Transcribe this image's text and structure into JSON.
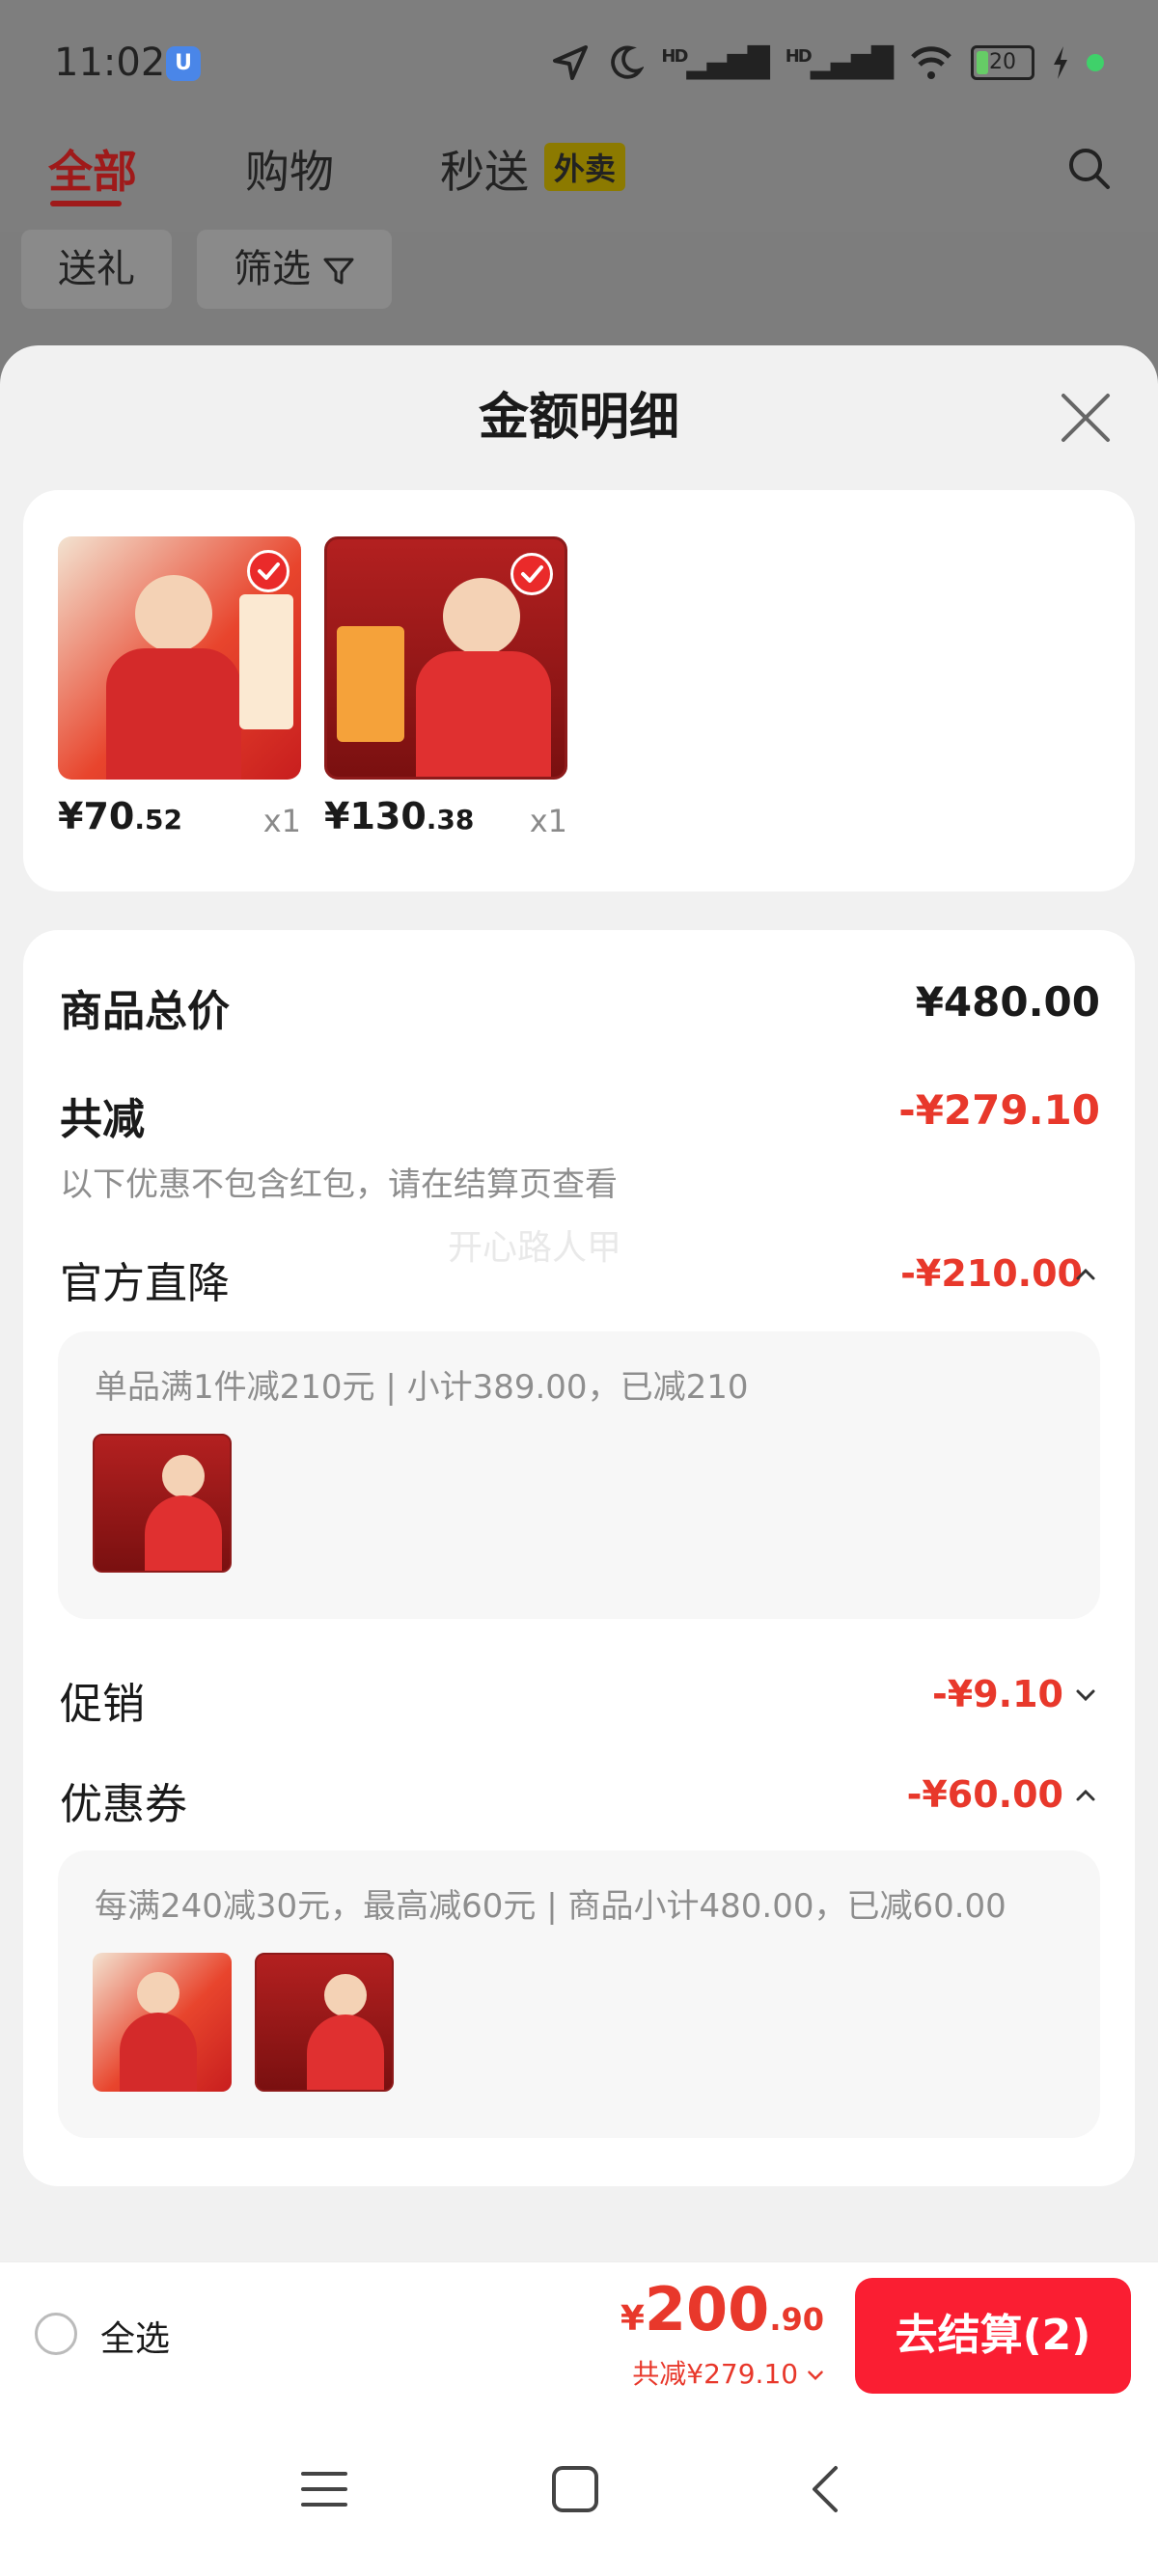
{
  "status_bar": {
    "time": "11:02",
    "battery": "20",
    "signal_1": "HD",
    "signal_2": "HD"
  },
  "top_tabs": [
    {
      "label": "全部",
      "active": true
    },
    {
      "label": "购物",
      "active": false
    },
    {
      "label": "秒送",
      "active": false
    }
  ],
  "waimai_badge": "外卖",
  "filters": {
    "gift_label": "送礼",
    "filter_label": "筛选"
  },
  "sheet": {
    "title": "金额明细",
    "watermark": "开心路人甲"
  },
  "products": [
    {
      "price_int": "¥70",
      "price_dec": ".52",
      "qty": "x1"
    },
    {
      "price_int": "¥130",
      "price_dec": ".38",
      "qty": "x1"
    }
  ],
  "details": {
    "total_label": "商品总价",
    "total_value": "¥480.00",
    "discount_label": "共减",
    "discount_value": "-¥279.10",
    "discount_note": "以下优惠不包含红包，请在结算页查看",
    "official_label": "官方直降",
    "official_value": "-¥210.00",
    "official_desc": "单品满1件减210元 | 小计389.00，已减210",
    "promo_label": "促销",
    "promo_value": "-¥9.10",
    "coupon_label": "优惠券",
    "coupon_value": "-¥60.00",
    "coupon_desc": "每满240减30元，最高减60元 | 商品小计480.00，已减60.00"
  },
  "bottom_bar": {
    "select_all": "全选",
    "currency": "¥",
    "total_int": "200",
    "total_dec": ".90",
    "total_saving": "共减¥279.10",
    "checkout_label": "去结算(2)"
  },
  "colors": {
    "accent_red": "#e8382b",
    "checkout_red": "#fa1e32"
  }
}
